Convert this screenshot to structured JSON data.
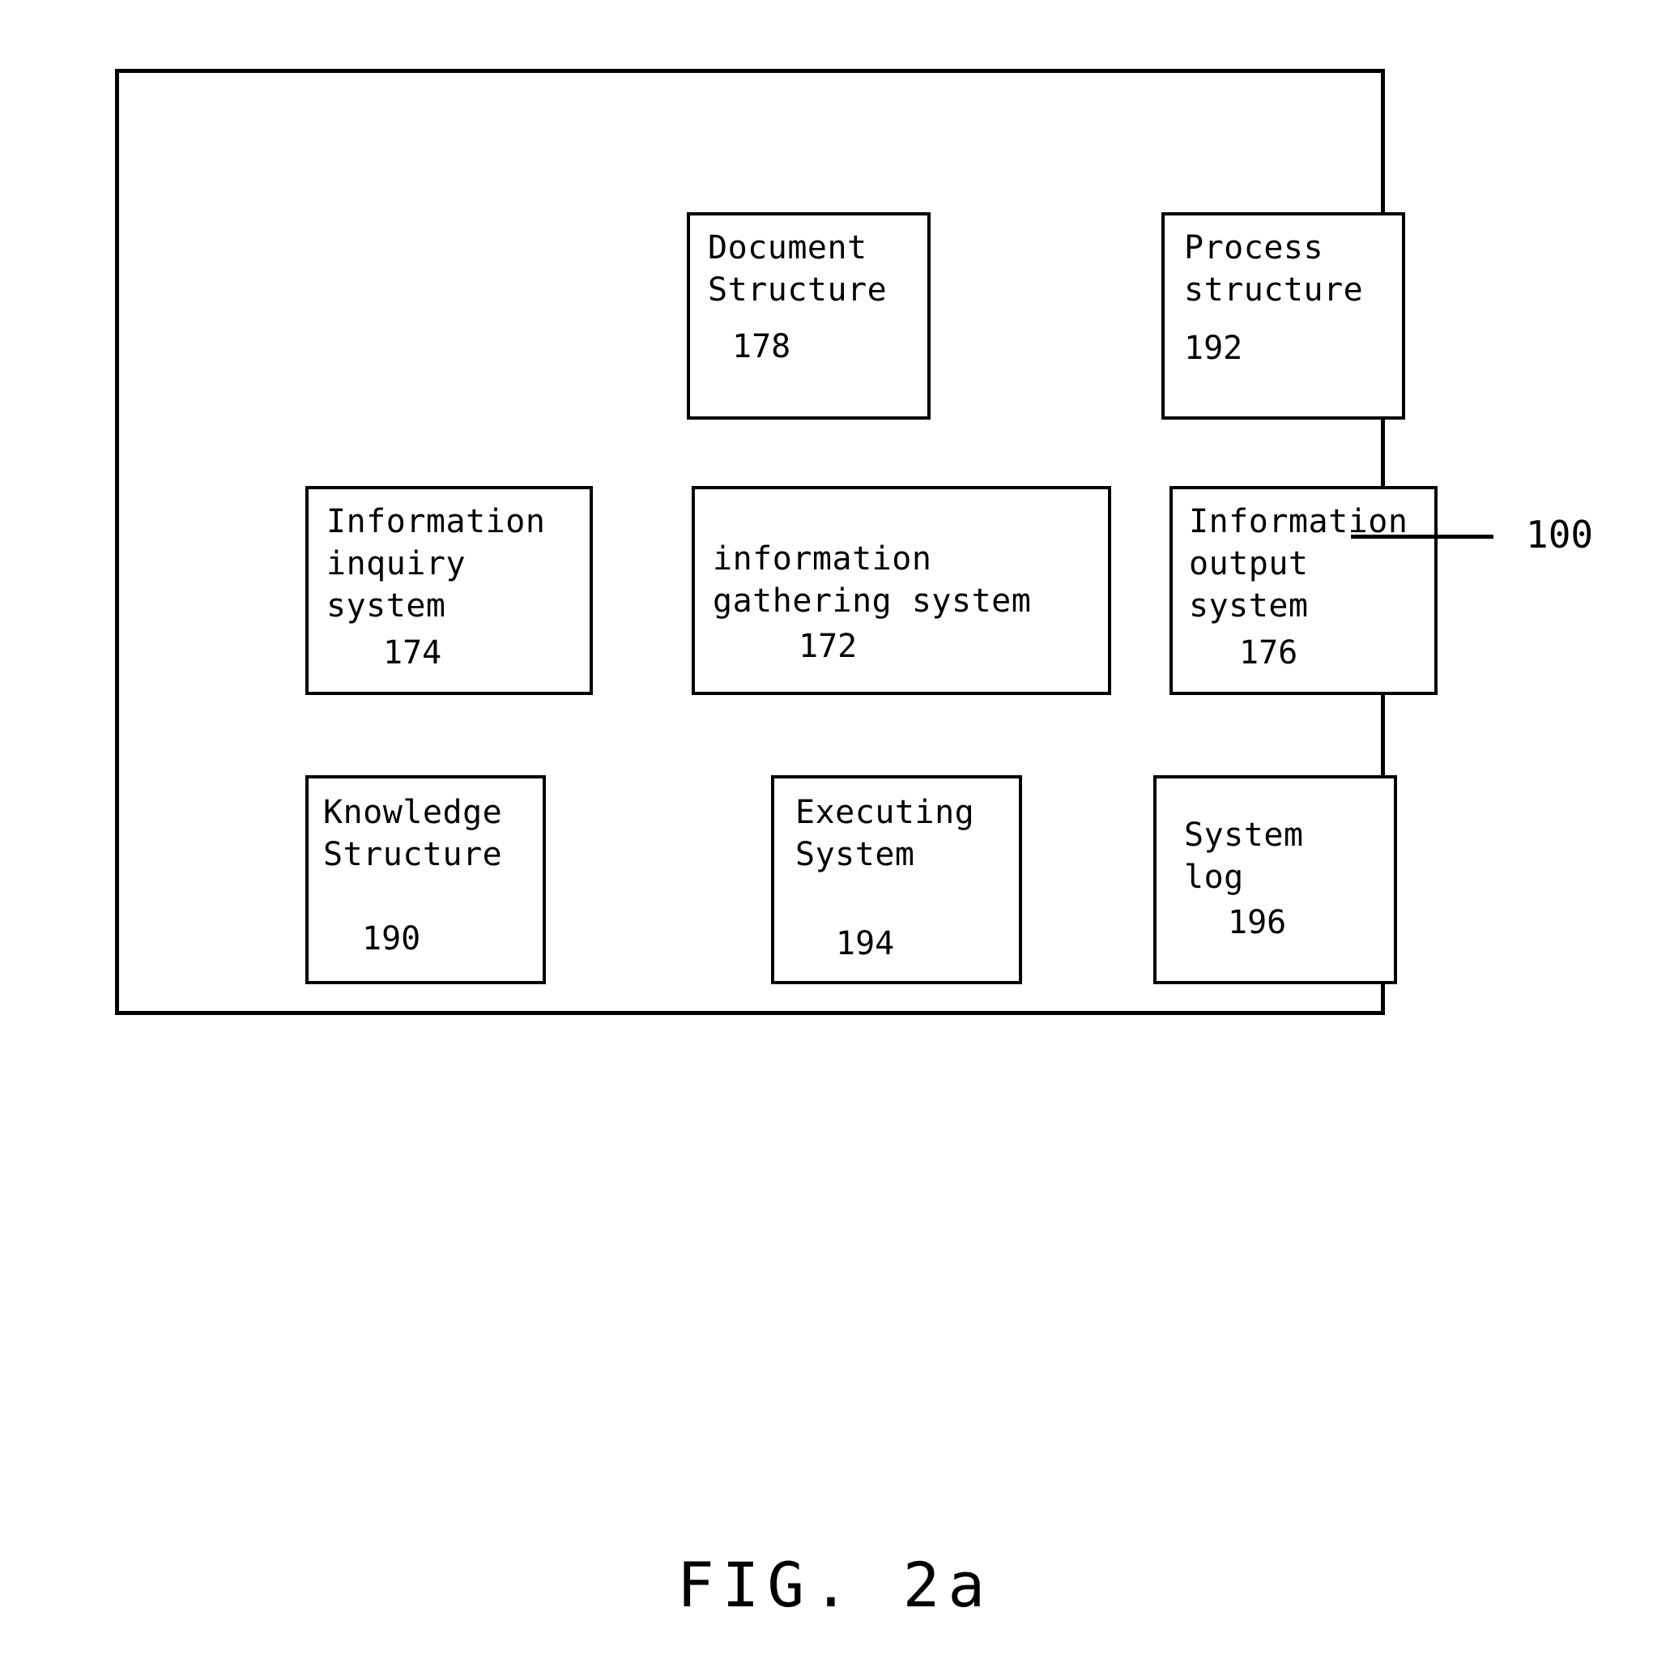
{
  "figure": {
    "caption": "FIG. 2a",
    "system_reference_numeral": "100"
  },
  "diagram": {
    "type": "block-diagram",
    "outer_container": {
      "name": "system-100",
      "reference": "100"
    },
    "blocks": [
      {
        "id": "document-structure",
        "row": "top",
        "column": "center",
        "lines": [
          "Document",
          "Structure"
        ],
        "reference": "178"
      },
      {
        "id": "process-structure",
        "row": "top",
        "column": "right",
        "lines": [
          "Process",
          "structure"
        ],
        "reference": "192"
      },
      {
        "id": "information-inquiry-system",
        "row": "middle",
        "column": "left",
        "lines": [
          "Information",
          "inquiry",
          "system"
        ],
        "reference": "174"
      },
      {
        "id": "information-gathering-system",
        "row": "middle",
        "column": "center",
        "lines": [
          "information",
          "gathering system"
        ],
        "reference": "172"
      },
      {
        "id": "information-output-system",
        "row": "middle",
        "column": "right",
        "lines": [
          "Information",
          "output",
          "system"
        ],
        "reference": "176"
      },
      {
        "id": "knowledge-structure",
        "row": "bottom",
        "column": "left",
        "lines": [
          "Knowledge",
          "Structure"
        ],
        "reference": "190"
      },
      {
        "id": "executing-system",
        "row": "bottom",
        "column": "center",
        "lines": [
          "Executing",
          "System"
        ],
        "reference": "194"
      },
      {
        "id": "system-log",
        "row": "bottom",
        "column": "right",
        "lines": [
          "System",
          "log"
        ],
        "reference": "196"
      }
    ]
  },
  "boxes": {
    "document_structure": {
      "line1": "Document",
      "line2": "Structure",
      "ref": "178"
    },
    "process_structure": {
      "line1": "Process",
      "line2": "structure",
      "ref": "192"
    },
    "information_inquiry": {
      "line1": "Information",
      "line2": "inquiry",
      "line3": "system",
      "ref": "174"
    },
    "information_gathering": {
      "line1": "information",
      "line2": "gathering system",
      "ref": "172"
    },
    "information_output": {
      "line1": "Information",
      "line2": "output",
      "line3": "system",
      "ref": "176"
    },
    "knowledge_structure": {
      "line1": "Knowledge",
      "line2": "Structure",
      "ref": "190"
    },
    "executing_system": {
      "line1": "Executing",
      "line2": "System",
      "ref": "194"
    },
    "system_log": {
      "line1": "System",
      "line2": "log",
      "ref": "196"
    }
  },
  "colors": {
    "ink": "#000000",
    "paper": "#ffffff"
  }
}
